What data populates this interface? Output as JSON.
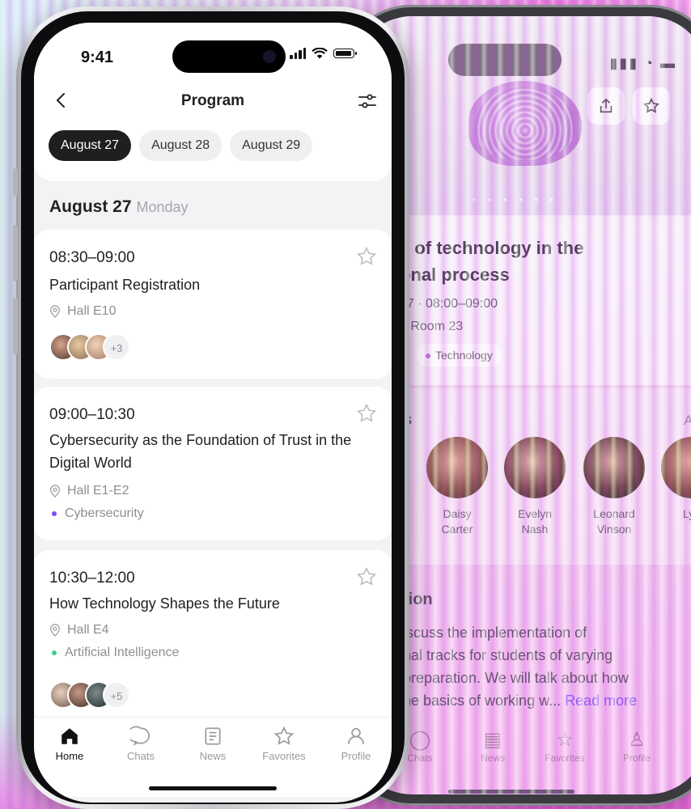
{
  "colors": {
    "accent_purple": "#7c4dff",
    "accent_green": "#3fcf8e",
    "active_tab_bg": "#1f1f22",
    "screen_bg": "#f3f3f5"
  },
  "status_bar": {
    "time": "9:41"
  },
  "header": {
    "title": "Program",
    "back_icon": "chevron-left-icon",
    "filter_icon": "sliders-icon"
  },
  "date_tabs": [
    {
      "label": "August 27",
      "active": true
    },
    {
      "label": "August 28",
      "active": false
    },
    {
      "label": "August 29",
      "active": false
    }
  ],
  "day": {
    "date": "August 27",
    "weekday": "Monday"
  },
  "sessions": [
    {
      "time": "08:30–09:00",
      "title": "Participant Registration",
      "hall": "Hall E10",
      "tag": "",
      "more": "+3"
    },
    {
      "time": "09:00–10:30",
      "title": "Cybersecurity as the Foundation of Trust in the Digital World",
      "hall": "Hall E1-E2",
      "tag": "Cybersecurity",
      "more": ""
    },
    {
      "time": "10:30–12:00",
      "title": "How Technology Shapes the Future",
      "hall": "Hall E4",
      "tag": "Artificial Intelligence",
      "more": "+5"
    }
  ],
  "tabbar": [
    {
      "label": "Home",
      "icon": "home-icon",
      "active": true
    },
    {
      "label": "Chats",
      "icon": "chat-icon",
      "active": false
    },
    {
      "label": "News",
      "icon": "news-icon",
      "active": false
    },
    {
      "label": "Favorites",
      "icon": "star-icon",
      "active": false
    },
    {
      "label": "Profile",
      "icon": "profile-icon",
      "active": false
    }
  ],
  "detail": {
    "title_line1": "e of technology in the",
    "title_line2": "onal process",
    "date_time": "17 · 08:00–09:00",
    "room": "e Room 23",
    "tag": "Technology",
    "speakers_title": "s",
    "all_link": "All",
    "speakers": [
      {
        "first": "Daisy",
        "last": "Carter"
      },
      {
        "first": "Evelyn",
        "last": "Nash"
      },
      {
        "first": "Leonard",
        "last": "Vinson"
      },
      {
        "first": "Lyu",
        "last": ""
      }
    ],
    "description_title": "tion",
    "description_lines": [
      "iscuss the implementation of",
      "nal tracks for students of varying",
      "preparation. We will talk about how",
      "he basics of working w..."
    ],
    "read_more": "Read more",
    "tabbar": [
      "Chats",
      "News",
      "Favorites",
      "Profile"
    ]
  }
}
